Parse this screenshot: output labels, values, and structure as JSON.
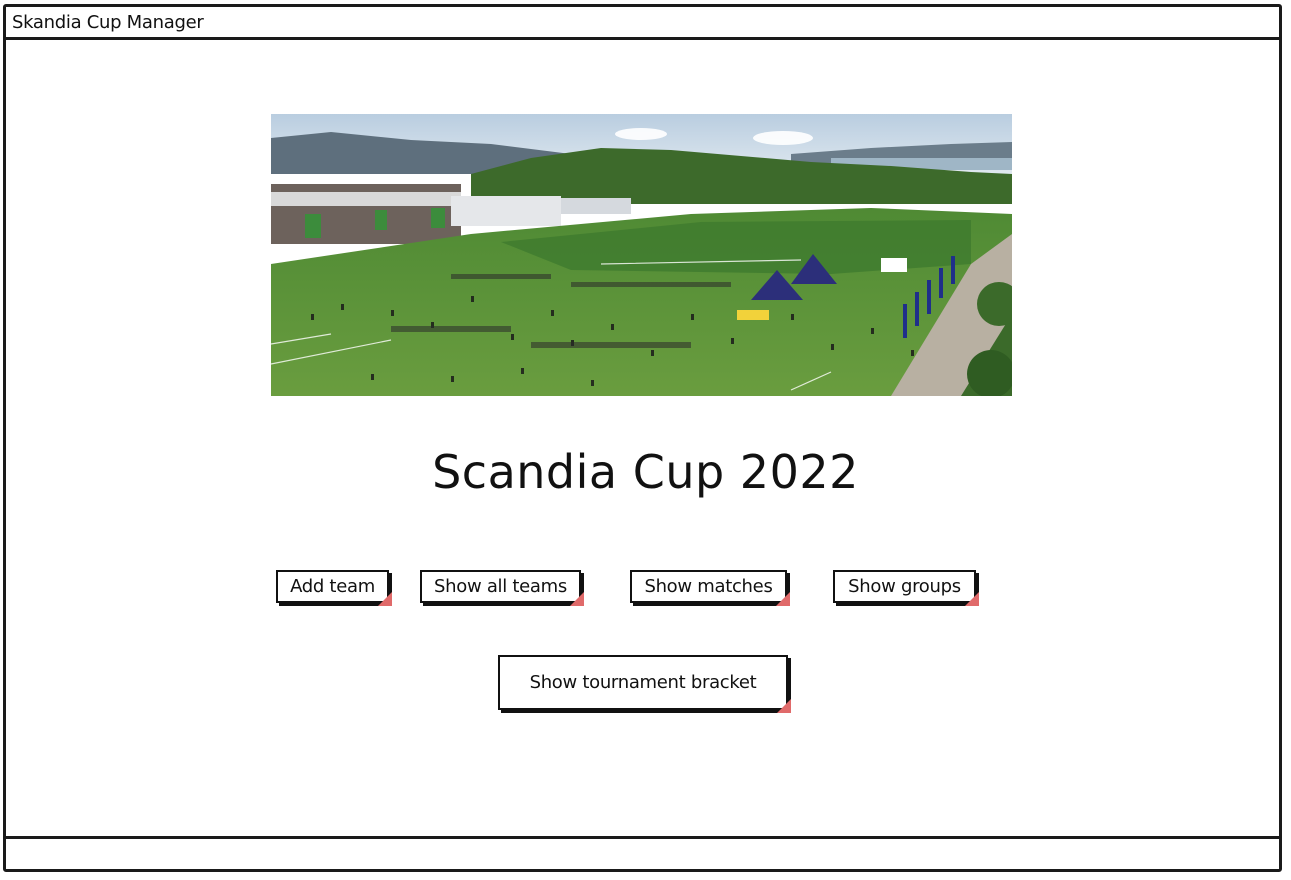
{
  "window": {
    "title": "Skandia Cup Manager"
  },
  "main": {
    "hero_image_alt": "tournament-field-photo",
    "headline": "Scandia Cup 2022",
    "buttons": {
      "add_team": "Add team",
      "show_all_teams": "Show all teams",
      "show_matches": "Show matches",
      "show_groups": "Show groups",
      "show_tournament_bracket": "Show tournament bracket"
    }
  },
  "colors": {
    "border": "#1a1a1a",
    "button_corner": "#e06a6a",
    "grass": "#5d8f3a",
    "sky": "#c9d8e6"
  }
}
